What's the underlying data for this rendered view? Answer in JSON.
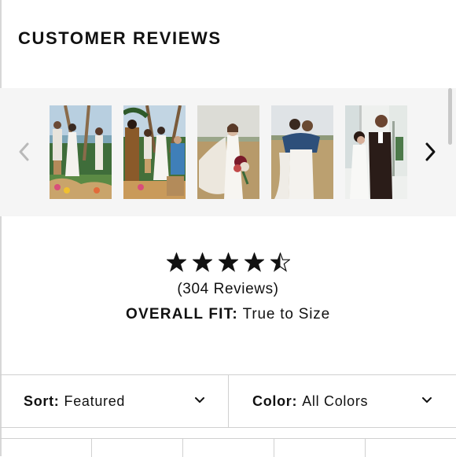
{
  "section": {
    "title": "CUSTOMER REVIEWS"
  },
  "carousel": {
    "prev_icon": "chevron-left-icon",
    "next_icon": "chevron-right-icon",
    "photos": [
      {
        "name": "beach-ceremony-photo"
      },
      {
        "name": "tropical-ceremony-photo"
      },
      {
        "name": "bride-field-photo"
      },
      {
        "name": "couple-embrace-photo"
      },
      {
        "name": "indoor-ceremony-photo"
      }
    ]
  },
  "rating": {
    "stars": 4.5,
    "max_stars": 5,
    "count_text": "(304 Reviews)"
  },
  "fit": {
    "label": "OVERALL FIT:",
    "value": "True to Size"
  },
  "filters": {
    "sort": {
      "label": "Sort:",
      "value": "Featured"
    },
    "color": {
      "label": "Color:",
      "value": "All Colors"
    }
  },
  "colors": {
    "text": "#111111",
    "carousel_bg": "#f5f5f5",
    "border": "#d0d0d0"
  }
}
